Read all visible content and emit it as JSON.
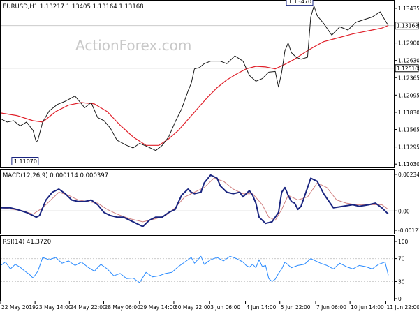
{
  "watermark": "ActionForex.com",
  "colors": {
    "price": "#1a1a1a",
    "ma": "#e0202a",
    "macd": "#1a2580",
    "signal": "#d08080",
    "rsi": "#2a8bff",
    "grid": "#cccccc",
    "watermark": "#c8c8c8"
  },
  "chart_data": [
    {
      "type": "line",
      "title": "EURUSD,H1  1.13217 1.13405 1.13164 1.13168",
      "ylim": [
        1.11,
        1.1352
      ],
      "yticks": [
        "1.13435",
        "1.13168",
        "1.12900",
        "1.12630",
        "1.12510",
        "1.12365",
        "1.12095",
        "1.11830",
        "1.11565",
        "1.11295",
        "1.11030"
      ],
      "grid_levels": [
        1.13168,
        1.1251
      ],
      "last_price": "1.13168",
      "level_label": "1.12510",
      "annotations": [
        {
          "text": "1.13470",
          "x": 192,
          "y": 1.1347
        },
        {
          "text": "1.11070",
          "x": 22,
          "y": 1.1107
        }
      ],
      "series": [
        {
          "x": [
            0,
            4,
            8,
            12,
            16,
            20,
            22,
            23,
            26,
            30,
            35,
            40,
            46,
            52,
            56,
            60,
            64,
            68,
            72,
            78,
            82,
            86,
            90,
            96,
            100,
            104,
            108,
            112,
            116,
            118,
            120,
            123,
            126,
            130,
            136,
            140,
            145,
            150,
            154,
            158,
            162,
            166,
            170,
            172,
            174,
            176,
            178,
            180,
            183,
            186,
            190,
            192,
            194,
            196,
            200,
            205,
            210,
            215,
            220,
            225,
            230,
            235,
            238,
            240
          ],
          "values": [
            1.1173,
            1.1168,
            1.117,
            1.1162,
            1.1168,
            1.1155,
            1.1137,
            1.114,
            1.1168,
            1.1185,
            1.1195,
            1.12,
            1.1208,
            1.119,
            1.1198,
            1.1175,
            1.117,
            1.1158,
            1.114,
            1.1132,
            1.1128,
            1.1135,
            1.1131,
            1.1124,
            1.1132,
            1.1145,
            1.1168,
            1.1188,
            1.1216,
            1.1228,
            1.125,
            1.1252,
            1.1258,
            1.1262,
            1.1262,
            1.1258,
            1.127,
            1.1262,
            1.124,
            1.1231,
            1.1235,
            1.1245,
            1.1246,
            1.1222,
            1.1245,
            1.1278,
            1.129,
            1.1275,
            1.1268,
            1.1265,
            1.1268,
            1.133,
            1.1347,
            1.1332,
            1.132,
            1.1302,
            1.1315,
            1.131,
            1.1322,
            1.1326,
            1.133,
            1.1338,
            1.1325,
            1.1317
          ]
        },
        {
          "x": [
            0,
            10,
            20,
            26,
            34,
            42,
            50,
            58,
            66,
            74,
            82,
            90,
            98,
            104,
            110,
            116,
            122,
            128,
            134,
            140,
            146,
            152,
            158,
            164,
            170,
            176,
            182,
            188,
            194,
            200,
            206,
            212,
            218,
            224,
            230,
            236,
            240
          ],
          "values": [
            1.1182,
            1.1178,
            1.117,
            1.1168,
            1.1184,
            1.1194,
            1.1198,
            1.1196,
            1.1184,
            1.1163,
            1.1145,
            1.1132,
            1.1132,
            1.1142,
            1.1155,
            1.1172,
            1.1189,
            1.1206,
            1.1221,
            1.1233,
            1.1242,
            1.125,
            1.1254,
            1.1253,
            1.125,
            1.1257,
            1.1265,
            1.1275,
            1.1284,
            1.1292,
            1.1296,
            1.13,
            1.1304,
            1.1307,
            1.131,
            1.1313,
            1.1317
          ]
        }
      ]
    },
    {
      "type": "line",
      "title": "MACD(12,26,9) 0.000114 0.000397",
      "ylim": [
        -0.00142,
        0.00252
      ],
      "yticks": [
        "0.002345",
        "0.00",
        "-0.001239"
      ],
      "series": [
        {
          "x": [
            0,
            6,
            10,
            16,
            22,
            24,
            28,
            32,
            36,
            40,
            44,
            48,
            52,
            56,
            60,
            64,
            68,
            72,
            76,
            80,
            84,
            88,
            92,
            96,
            100,
            104,
            108,
            112,
            116,
            118,
            120,
            124,
            126,
            130,
            134,
            136,
            140,
            144,
            148,
            150,
            152,
            154,
            156,
            158,
            160,
            164,
            168,
            172,
            174,
            176,
            178,
            180,
            182,
            184,
            186,
            188,
            192,
            196,
            200,
            206,
            212,
            218,
            222,
            228,
            232,
            236,
            240
          ],
          "values": [
            0.0002,
            0.0002,
            0.0001,
            -0.0001,
            -0.0004,
            -0.0003,
            0.0007,
            0.0012,
            0.0014,
            0.0011,
            0.0007,
            0.0006,
            0.0006,
            0.0007,
            0.0004,
            -0.0001,
            -0.0003,
            -0.0004,
            -0.0004,
            -0.0006,
            -0.0008,
            -0.001,
            -0.0006,
            -0.0004,
            -0.0004,
            -0.0001,
            0.0001,
            0.001,
            0.0014,
            0.0012,
            0.0011,
            0.0012,
            0.0018,
            0.0023,
            0.0021,
            0.0016,
            0.0012,
            0.0011,
            0.0012,
            0.0009,
            0.0011,
            0.0013,
            0.001,
            0.0005,
            -0.0004,
            -0.0008,
            -0.0007,
            -0.0001,
            0.0012,
            0.0015,
            0.001,
            0.0006,
            0.0005,
            0.0001,
            0.0003,
            0.0009,
            0.0021,
            0.0019,
            0.0011,
            0.0002,
            0.0003,
            0.0004,
            0.0003,
            0.0004,
            0.0005,
            0.0002,
            -0.0002
          ]
        },
        {
          "x": [
            0,
            8,
            14,
            20,
            26,
            30,
            36,
            42,
            48,
            54,
            60,
            66,
            72,
            80,
            88,
            96,
            102,
            108,
            114,
            120,
            126,
            132,
            138,
            144,
            150,
            156,
            162,
            166,
            170,
            174,
            178,
            184,
            190,
            196,
            202,
            208,
            214,
            220,
            226,
            232,
            236,
            240
          ],
          "values": [
            0.0002,
            0.0001,
            0.0,
            -0.0002,
            0.0002,
            0.0006,
            0.0012,
            0.001,
            0.0007,
            0.0006,
            0.0005,
            0.0001,
            -0.0002,
            -0.0005,
            -0.0007,
            -0.0005,
            -0.0003,
            0.0002,
            0.0009,
            0.0012,
            0.0015,
            0.0021,
            0.0019,
            0.0014,
            0.0011,
            0.0011,
            0.0004,
            -0.0004,
            -0.0006,
            0.0001,
            0.001,
            0.0007,
            0.0009,
            0.0018,
            0.0015,
            0.0007,
            0.0005,
            0.0004,
            0.0004,
            0.0004,
            0.0004,
            0.0001
          ]
        }
      ]
    },
    {
      "type": "line",
      "title": "RSI(14) 41.3720",
      "ylim": [
        0,
        100
      ],
      "yticks": [
        "100",
        "70",
        "30",
        "0"
      ],
      "grid_levels": [
        70,
        30
      ],
      "series": [
        {
          "x": [
            0,
            3,
            6,
            9,
            12,
            15,
            18,
            20,
            23,
            26,
            30,
            34,
            38,
            42,
            46,
            50,
            54,
            58,
            62,
            66,
            70,
            74,
            78,
            82,
            86,
            90,
            94,
            98,
            102,
            106,
            110,
            114,
            118,
            120,
            124,
            126,
            130,
            134,
            138,
            142,
            146,
            150,
            152,
            154,
            156,
            158,
            160,
            162,
            164,
            166,
            168,
            170,
            172,
            174,
            176,
            180,
            184,
            188,
            192,
            195,
            198,
            202,
            206,
            210,
            214,
            218,
            222,
            226,
            230,
            234,
            238,
            240
          ],
          "values": [
            58,
            64,
            52,
            60,
            55,
            48,
            42,
            36,
            48,
            72,
            68,
            72,
            62,
            66,
            58,
            64,
            55,
            48,
            60,
            52,
            40,
            44,
            35,
            36,
            28,
            46,
            38,
            40,
            44,
            46,
            56,
            64,
            72,
            62,
            74,
            60,
            68,
            72,
            66,
            74,
            70,
            64,
            58,
            55,
            60,
            54,
            68,
            56,
            58,
            35,
            30,
            34,
            44,
            52,
            64,
            54,
            58,
            60,
            70,
            66,
            62,
            58,
            52,
            62,
            56,
            52,
            58,
            56,
            52,
            60,
            64,
            41
          ]
        }
      ]
    }
  ],
  "time_axis": [
    {
      "x": 0,
      "label": "22 May 2019"
    },
    {
      "x": 23,
      "label": "23 May 14:00"
    },
    {
      "x": 46,
      "label": "24 May 22:00"
    },
    {
      "x": 69,
      "label": "28 May 06:00"
    },
    {
      "x": 93,
      "label": "29 May 14:00"
    },
    {
      "x": 116,
      "label": "30 May 22:00"
    },
    {
      "x": 140,
      "label": "3 Jun 06:00"
    },
    {
      "x": 164,
      "label": "4 Jun 14:00"
    },
    {
      "x": 187,
      "label": "5 Jun 22:00"
    },
    {
      "x": 211,
      "label": "7 Jun 06:00"
    },
    {
      "x": 234,
      "label": "10 Jun 14:00"
    },
    {
      "x": 258,
      "label": "11 Jun 22:00"
    }
  ]
}
